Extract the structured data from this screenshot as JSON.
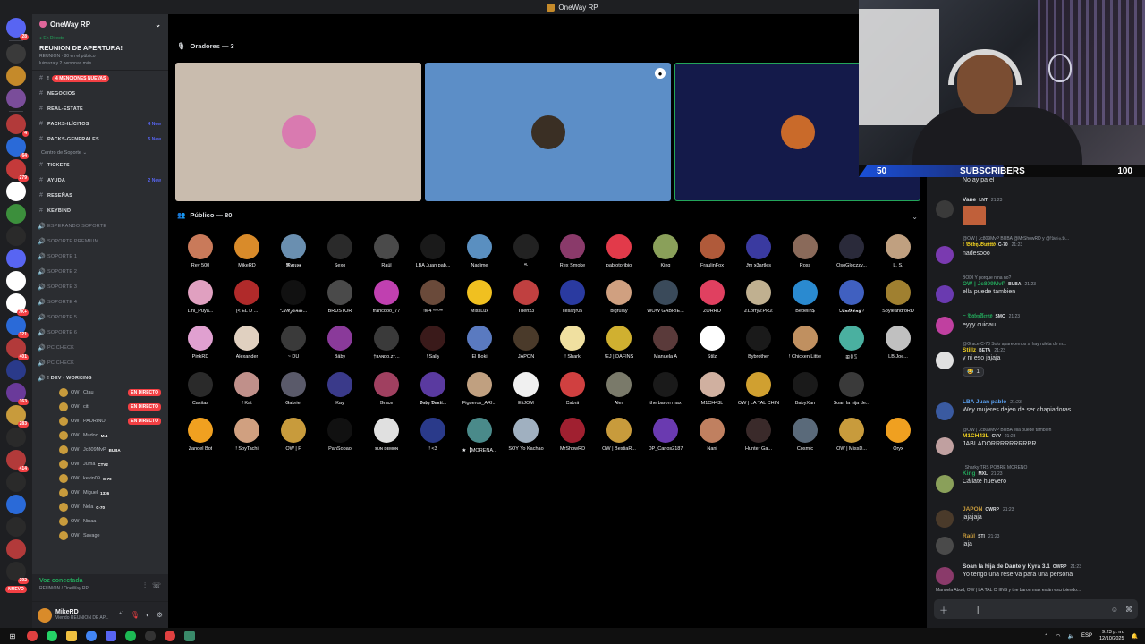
{
  "window": {
    "title": "OneWay RP"
  },
  "guild_rail": {
    "colors": [
      "#5865f2",
      "#3a3a3a",
      "#c58a2a",
      "#7a4d9a",
      "#b23a3a",
      "#2a6ad8",
      "#c43a3a",
      "#ffffff",
      "#3c8f3c",
      "#2a2a2a",
      "#5865f2",
      "#ffffff",
      "#ffffff",
      "#2a6ad8",
      "#b23a3a",
      "#2a3a8a",
      "#6a3a9a",
      "#c89b3c",
      "#2a2a2a",
      "#b23a3a",
      "#2a2a2a",
      "#2a6ad8",
      "#2a2a2a",
      "#b23a3a",
      "#2a2a2a"
    ],
    "badges": [
      "28",
      "",
      "",
      "",
      "4",
      "64",
      "279",
      "",
      "",
      "",
      "",
      "",
      "7K+",
      "321",
      "401",
      "",
      "163",
      "283",
      "",
      "414",
      "",
      "",
      "",
      "",
      "392"
    ],
    "new_label": "NUEVO"
  },
  "sidebar": {
    "server_name": "OneWay RP",
    "event": {
      "live_label": "En Directo",
      "name": "REUNION DE APERTURA!",
      "meta": "REUNION · 80 en el público",
      "meta2": "luimaza y 2 personas más"
    },
    "channels": [
      {
        "icon": "#",
        "label": "!",
        "mention": "4 MENCIONES NUEVAS",
        "new": ""
      },
      {
        "icon": "#",
        "label": "NEGOCIOS",
        "mention": "",
        "new": ""
      },
      {
        "icon": "#",
        "label": "REAL-ESTATE",
        "mention": "",
        "new": ""
      },
      {
        "icon": "#",
        "label": "PACKS-ILÍCITOS",
        "mention": "",
        "new": "4 New"
      },
      {
        "icon": "#",
        "label": "PACKS-GENERALES",
        "mention": "",
        "new": "5 New"
      }
    ],
    "category": "Centro de Soporte",
    "support_channels": [
      {
        "icon": "#",
        "label": "TICKETS",
        "new": ""
      },
      {
        "icon": "#",
        "label": "AYUDA",
        "new": "2 New"
      },
      {
        "icon": "#",
        "label": "RESEÑAS",
        "new": ""
      },
      {
        "icon": "#",
        "label": "KEYBIND",
        "new": ""
      },
      {
        "icon": "🔊",
        "label": "ESPERANDO SOPORTE",
        "new": ""
      },
      {
        "icon": "🔊",
        "label": "SOPORTE PREMIUM",
        "new": ""
      },
      {
        "icon": "🔊",
        "label": "SOPORTE 1",
        "new": ""
      },
      {
        "icon": "🔊",
        "label": "SOPORTE 2",
        "new": ""
      },
      {
        "icon": "🔊",
        "label": "SOPORTE 3",
        "new": ""
      },
      {
        "icon": "🔊",
        "label": "SOPORTE 4",
        "new": ""
      },
      {
        "icon": "🔊",
        "label": "SOPORTE 5",
        "new": ""
      },
      {
        "icon": "🔊",
        "label": "SOPORTE 6",
        "new": ""
      },
      {
        "icon": "🔊",
        "label": "PC CHECK",
        "new": ""
      },
      {
        "icon": "🔊",
        "label": "PC CHECK",
        "new": ""
      },
      {
        "icon": "🔊",
        "label": "! DEV - WORKING",
        "new": ""
      }
    ],
    "voice_users": [
      {
        "name": "OW | Ctau",
        "tag": "",
        "live": "EN DIRECTO"
      },
      {
        "name": "OW | citi",
        "tag": "",
        "live": "EN DIRECTO"
      },
      {
        "name": "OW | PADRINO",
        "tag": "",
        "live": "EN DIRECTO"
      },
      {
        "name": "OW | Mudoo",
        "tag": "M.4",
        "live": ""
      },
      {
        "name": "OW | Jc809MvP",
        "tag": "BUBA",
        "live": ""
      },
      {
        "name": "OW | Juma",
        "tag": "CTV2",
        "live": ""
      },
      {
        "name": "OW | kevin09",
        "tag": "C-70",
        "live": ""
      },
      {
        "name": "OW | Miguel",
        "tag": "1336",
        "live": ""
      },
      {
        "name": "OW | Nela",
        "tag": "C-70",
        "live": ""
      },
      {
        "name": "OW | Ninaa",
        "tag": "",
        "live": ""
      },
      {
        "name": "OW | Savage",
        "tag": "",
        "live": ""
      }
    ],
    "voice_status": {
      "title": "Voz conectada",
      "subtitle": "REUNION / OneWay RP"
    },
    "user": {
      "name": "MikeRD",
      "status": "Viendo REUNION DE AP...",
      "extra": "+1"
    }
  },
  "stage": {
    "speakers_header": "Oradores — 3",
    "audience_header": "Público — 80",
    "speakers": [
      {
        "bg": "#c9bcae",
        "avatar": "#d97ab0"
      },
      {
        "bg": "#5c8ec7",
        "avatar": "#3a2f24"
      },
      {
        "bg": "#141a4a",
        "avatar": "#c96a2a"
      }
    ],
    "audience": [
      [
        "Rey 500",
        "#c97a5a"
      ],
      [
        "MikeRD",
        "#d98b2a"
      ],
      [
        "𝕸𝖆𝖗𝖈𝖔𝖘",
        "#6a8fb0"
      ],
      [
        "Sexo",
        "#2a2a2a"
      ],
      [
        "Raúl",
        "#4a4a4a"
      ],
      [
        "LBA Juan pab...",
        "#1a1a1a"
      ],
      [
        "Nadime",
        "#5a8fc0"
      ],
      [
        "ᴬᴸ",
        "#222"
      ],
      [
        "Rex Smoke",
        "#8a3a6a"
      ],
      [
        "pablotoribio",
        "#e23a4a"
      ],
      [
        "King",
        "#8aa05a"
      ],
      [
        "FraulinFox",
        "#b05a3a"
      ],
      [
        "Ɉm ʞ3artles",
        "#3a3aa0"
      ],
      [
        "Ross",
        "#8a6a5a"
      ],
      [
        "OsoGloczzy...",
        "#2a2a3a"
      ],
      [
        "L. S.",
        "#c0a080"
      ],
      [
        "Lini_Puya...",
        "#e0a0c0"
      ],
      [
        "(< EL D ...",
        "#b02a2a"
      ],
      [
        "*𝒜𝓁𝑒𝒿𝒶𝓃𝒹𝓇...",
        "#111"
      ],
      [
        "BRUSTOR",
        "#4a4a4a"
      ],
      [
        "francooo_77",
        "#c040b0"
      ],
      [
        "!M4 ⁿᵒ ᴰᴹ",
        "#6a4a3a"
      ],
      [
        "MissLux",
        "#f0c020"
      ],
      [
        "Thehx3",
        "#c04040"
      ],
      [
        "cesarjr05",
        "#2a3aa0"
      ],
      [
        "bigrulay",
        "#d0a080"
      ],
      [
        "WOW GABRIE...",
        "#3a4a5a"
      ],
      [
        "ZORRO",
        "#e04060"
      ],
      [
        "ℤLorryℤPRℤ",
        "#c0b090"
      ],
      [
        "Bebelin$",
        "#2a8ad0"
      ],
      [
        "!𝓐𝓷𝓽𝓱𝓸𝓷𝔂?",
        "#4060c0"
      ],
      [
        "SoyleandroRD",
        "#a08030"
      ],
      [
        "PinkRD",
        "#e0a0d0"
      ],
      [
        "Alexander",
        "#e0d0c0"
      ],
      [
        "~ DÚ",
        "#3a3a3a"
      ],
      [
        "Bäby",
        "#8a3a9a"
      ],
      [
        "†ʙᴀɴᴅᴏ.ᴢᴛ...",
        "#3a3a3a"
      ],
      [
        "! Sally",
        "#3a1a1a"
      ],
      [
        "El Boki",
        "#5a7ac0"
      ],
      [
        "JAPON",
        "#4a3a2a"
      ],
      [
        "! Shark",
        "#f0e0a0"
      ],
      [
        "!EJ | DAFINS",
        "#d0b030"
      ],
      [
        "Manuela A",
        "#5a3a3a"
      ],
      [
        "Stilz",
        "#ffffff"
      ],
      [
        "Bybrother",
        "#1a1a1a"
      ],
      [
        "! Chicken Little",
        "#c09060"
      ],
      [
        "ꕥꂦꌗ",
        "#4ab0a0"
      ],
      [
        "LB Joe...",
        "#c0c0c0"
      ],
      [
        "Casitas",
        "#2a2a2a"
      ],
      [
        "! Kat",
        "#c0908a"
      ],
      [
        "Gabriel",
        "#5a5a6a"
      ],
      [
        "Kay",
        "#3a3a8a"
      ],
      [
        "Grace",
        "#a04060"
      ],
      [
        "𝕭𝖆𝖇𝖞 𝕭𝖚𝖓𝖎𝖙...",
        "#5a3aa0"
      ],
      [
        "Figueros_ARI...",
        "#c0a080"
      ],
      [
        "EliJOM",
        "#f0f0f0"
      ],
      [
        "Cabrá",
        "#d04040"
      ],
      [
        "Alex",
        "#7a7a6a"
      ],
      [
        "the baron max",
        "#1a1a1a"
      ],
      [
        "M1CH43L",
        "#d0b0a0"
      ],
      [
        "OW | LA TAL CHIN",
        "#d0a030"
      ],
      [
        "BabyXan",
        "#1a1a1a"
      ],
      [
        "Soan la hija de...",
        "#3a3a3a"
      ],
      [
        "",
        "#000000"
      ],
      [
        "Zandel Bot",
        "#f0a020"
      ],
      [
        "! SoyTachi",
        "#d0a080"
      ],
      [
        "OW | F",
        "#c89b3c"
      ],
      [
        "PanSobao",
        "#111"
      ],
      [
        "ꜱᴜɴ ᴅᴇᴍᴏɴ",
        "#e0e0e0"
      ],
      [
        "! <3",
        "#2a3a8a"
      ],
      [
        "★【MORENA...",
        "#4a8a8a"
      ],
      [
        "SOY Yo Kachao",
        "#a0b0c0"
      ],
      [
        "MrShowRD",
        "#a02030"
      ],
      [
        "OW | BestiaR...",
        "#c89b3c"
      ],
      [
        "DP_Carlos2187",
        "#6a3ab0"
      ],
      [
        "Nani",
        "#c08060"
      ],
      [
        "Hunter Ga...",
        "#3a2a2a"
      ],
      [
        "Cosmic",
        "#5a6a7a"
      ],
      [
        "OW | MissD...",
        "#c89b3c"
      ],
      [
        "Oryx",
        "#f0a020"
      ]
    ]
  },
  "stream": {
    "subs_current": "50",
    "subs_label": "SUBSCRIBERS",
    "subs_goal": "100",
    "progress": 0.5
  },
  "chat": {
    "messages": [
      {
        "reply": "",
        "author": "",
        "color": "#dbdee1",
        "tag": "",
        "time": "",
        "text": "No ay pa el",
        "avatar": ""
      },
      {
        "reply": "",
        "author": "Vane",
        "color": "#dbdee1",
        "tag": "LNT",
        "time": "21:23",
        "text": "",
        "avatar": "#3a3a3a"
      },
      {
        "reply": "@OW | Jc809MvP BUBA @MrShowRD y @!𝔅𝔞𝔟𝔶.𝔅...",
        "author": "! 𝔅𝔞𝔟𝔶.𝔅𝔲𝔫𝔦𝔱𝔬",
        "color": "#f0d020",
        "tag": "C-70",
        "time": "21:23",
        "text": "nadesooo",
        "avatar": "#7a3ab0"
      },
      {
        "reply": "BODI  Y porque nina no?",
        "author": "OW | Jc809MvP",
        "color": "#23a55a",
        "tag": "BUBA",
        "time": "21:23",
        "text": "ella puede tambien",
        "avatar": "#6a3ab0"
      },
      {
        "reply": "",
        "author": "~ 𝔅𝔞𝔟𝔶𝔄𝔢𝔪𝔬",
        "color": "#23a55a",
        "tag": "SMC",
        "time": "21:23",
        "text": "eyyy cuidau",
        "avatar": "#c040a0"
      },
      {
        "reply": "@Grace C-70  Solo aparecemos si hay ruleta de m...",
        "author": "Stillz",
        "color": "#f0d020",
        "tag": "BETA",
        "time": "21:23",
        "text": "y ni eso jajaja",
        "avatar": "#e0e0e0"
      },
      {
        "reply": "",
        "author": "LBA Juan pablo",
        "color": "#5aa0f0",
        "tag": "",
        "time": "21:23",
        "text": "Wey mujeres dejen de ser chapiadoras",
        "avatar": "#3a5aa0"
      },
      {
        "reply": "@OW | Jc809MvP BUBA  ella puede tambien",
        "author": "M1CH43L",
        "color": "#f0d020",
        "tag": "CVV",
        "time": "21:23",
        "text": "JABLADORRRRRRRRRR",
        "avatar": "#c0a0a0"
      },
      {
        "reply": "! Sharky TRS  POBRE MORENO",
        "author": "King",
        "color": "#23a55a",
        "tag": "MXL",
        "time": "21:23",
        "text": "Cállate huevero",
        "avatar": "#8aa05a"
      },
      {
        "reply": "",
        "author": "JAPON",
        "color": "#c89b3c",
        "tag": "OWRP",
        "time": "21:23",
        "text": "jajajaja",
        "avatar": "#4a3a2a"
      },
      {
        "reply": "",
        "author": "Raúl",
        "color": "#c89b3c",
        "tag": "STI",
        "time": "21:23",
        "text": "jaja",
        "avatar": "#4a4a4a"
      },
      {
        "reply": "",
        "author": "Soan la hija de Dante y Kyra 3.1",
        "color": "#dbdee1",
        "tag": "OWRP",
        "time": "21:23",
        "text": "Yo tengo una reserva para una persona",
        "avatar": "#8a3a6a"
      }
    ],
    "reaction_count": "1",
    "typing": "Manuela Abud, OW | LA TAL CHINS y the baron max están escribiendo...",
    "input_placeholder": ""
  },
  "taskbar": {
    "lang": "ESP",
    "time": "9:23 p. m.",
    "date": "12/10/2025"
  }
}
